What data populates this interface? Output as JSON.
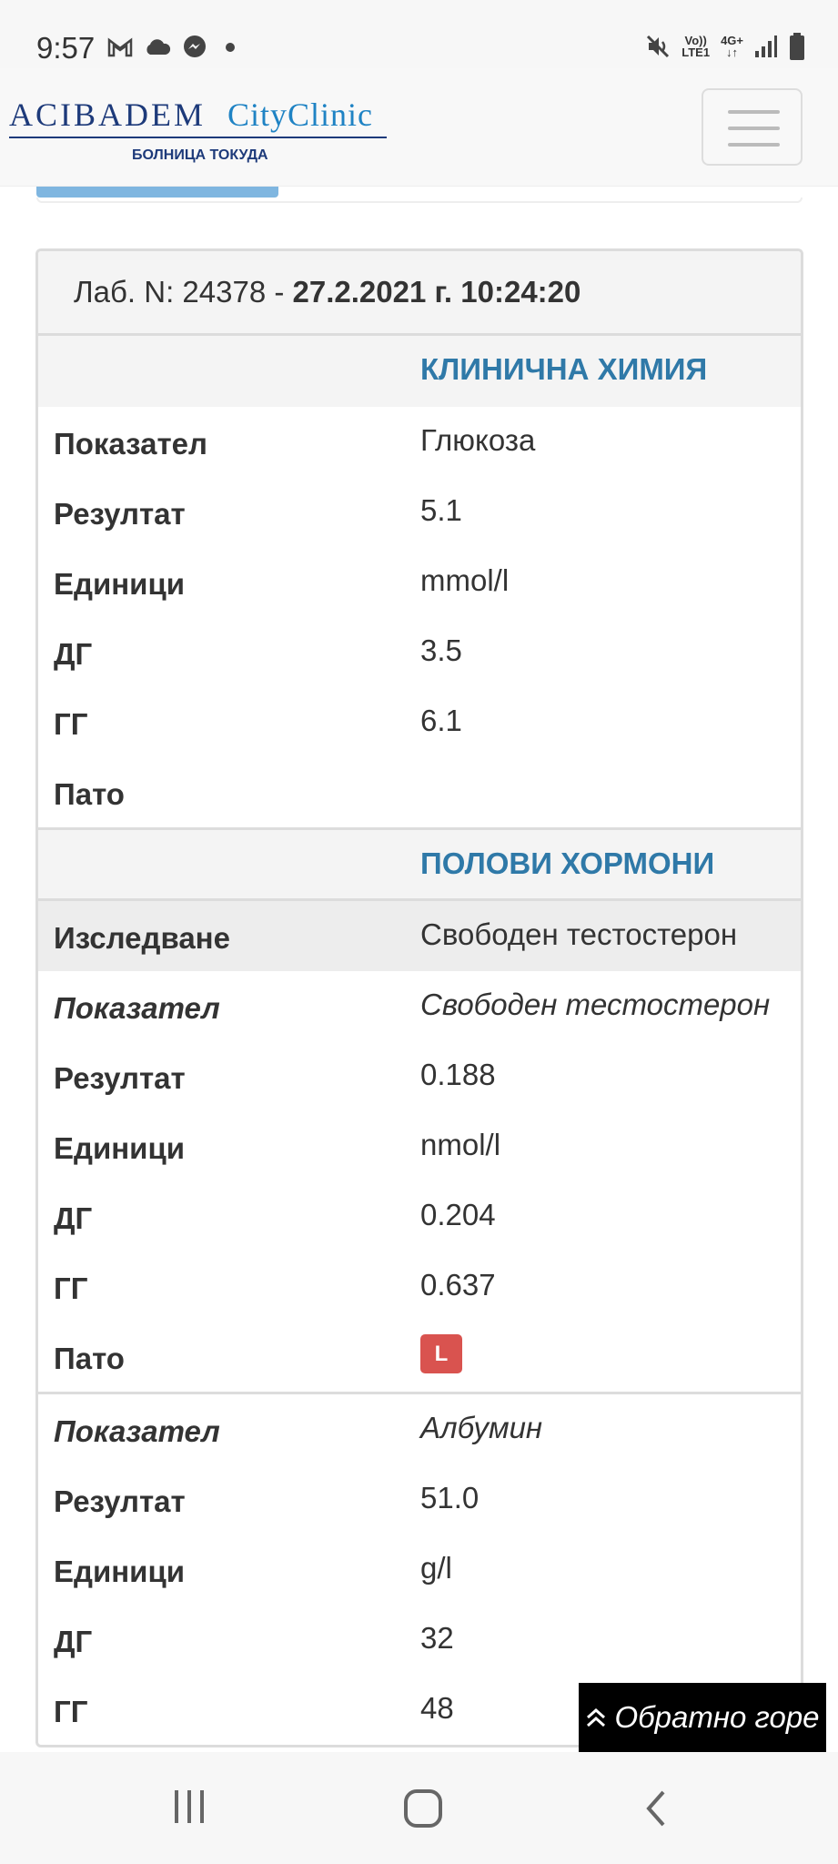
{
  "status_bar": {
    "time": "9:57",
    "icons_left": [
      "gmail-icon",
      "cloud-icon",
      "messenger-icon",
      "dot-icon"
    ],
    "volte_top": "Vo))",
    "volte_bottom": "LTE1",
    "network": "4G+",
    "icons_right": [
      "mute-icon",
      "signal-icon",
      "battery-icon"
    ]
  },
  "header": {
    "logo_main": "ACIBADEM",
    "logo_city": "CityClinic",
    "logo_sub": "БОЛНИЦА ТОКУДА",
    "menu_icon": "hamburger-icon"
  },
  "panel": {
    "lab_prefix": "Лаб. N: 24378 - ",
    "lab_date": "27.2.2021 г. 10:24:20"
  },
  "sections": [
    {
      "title": "КЛИНИЧНА ХИМИЯ",
      "rows": [
        {
          "label": "Показател",
          "value": "Глюкоза"
        },
        {
          "label": "Резултат",
          "value": "5.1"
        },
        {
          "label": "Единици",
          "value": "mmol/l"
        },
        {
          "label": "ДГ",
          "value": "3.5"
        },
        {
          "label": "ГГ",
          "value": "6.1"
        },
        {
          "label": "Пато",
          "value": ""
        }
      ]
    },
    {
      "title": "ПОЛОВИ ХОРМОНИ",
      "study": {
        "label": "Изследване",
        "value": "Свободен тестостерон"
      },
      "rows": [
        {
          "label": "Показател",
          "value": "Свободен тестостерон"
        },
        {
          "label": "Резултат",
          "value": "0.188"
        },
        {
          "label": "Единици",
          "value": "nmol/l"
        },
        {
          "label": "ДГ",
          "value": "0.204"
        },
        {
          "label": "ГГ",
          "value": "0.637"
        },
        {
          "label": "Пато",
          "badge": "L",
          "badge_color": "#d9534f"
        }
      ],
      "rows2": [
        {
          "label": "Показател",
          "value": "Албумин"
        },
        {
          "label": "Резултат",
          "value": "51.0"
        },
        {
          "label": "Единици",
          "value": "g/l"
        },
        {
          "label": "ДГ",
          "value": "32"
        },
        {
          "label": "ГГ",
          "value": "48"
        }
      ]
    }
  ],
  "back_to_top": {
    "label": "Обратно горе",
    "icon": "double-chevron-up-icon"
  },
  "nav_bar": {
    "icons": [
      "recent-apps-icon",
      "home-icon",
      "back-icon"
    ]
  },
  "colors": {
    "section_title": "#2f79a8",
    "badge": "#d9534f",
    "logo_blue": "#1d3a7a",
    "logo_city": "#1f83c4"
  }
}
